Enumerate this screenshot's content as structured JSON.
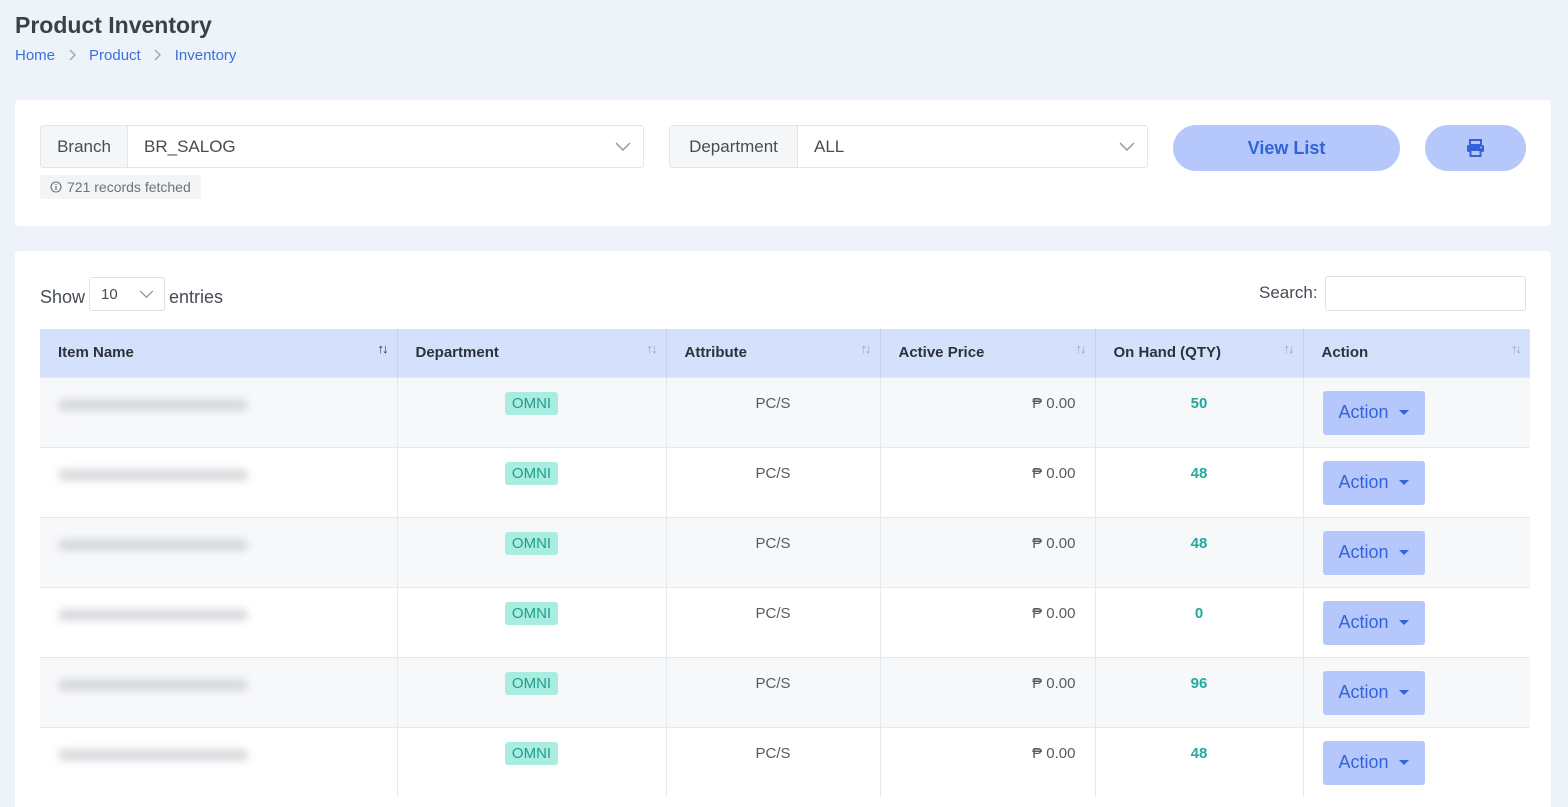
{
  "page": {
    "title": "Product Inventory",
    "breadcrumb": [
      "Home",
      "Product",
      "Inventory"
    ]
  },
  "filters": {
    "branch_label": "Branch",
    "branch_value": "BR_SALOG",
    "department_label": "Department",
    "department_value": "ALL",
    "records_fetched": "721 records fetched",
    "view_list_label": "View List",
    "print_icon": "print-icon"
  },
  "table_controls": {
    "show_label": "Show",
    "entries_value": "10",
    "entries_label": "entries",
    "search_label": "Search:",
    "search_value": ""
  },
  "columns": [
    "Item Name",
    "Department",
    "Attribute",
    "Active Price",
    "On Hand (QTY)",
    "Action"
  ],
  "rows": [
    {
      "department": "OMNI",
      "attribute": "PC/S",
      "price": "₱ 0.00",
      "qty": "50",
      "action": "Action"
    },
    {
      "department": "OMNI",
      "attribute": "PC/S",
      "price": "₱ 0.00",
      "qty": "48",
      "action": "Action"
    },
    {
      "department": "OMNI",
      "attribute": "PC/S",
      "price": "₱ 0.00",
      "qty": "48",
      "action": "Action"
    },
    {
      "department": "OMNI",
      "attribute": "PC/S",
      "price": "₱ 0.00",
      "qty": "0",
      "action": "Action"
    },
    {
      "department": "OMNI",
      "attribute": "PC/S",
      "price": "₱ 0.00",
      "qty": "96",
      "action": "Action"
    },
    {
      "department": "OMNI",
      "attribute": "PC/S",
      "price": "₱ 0.00",
      "qty": "48",
      "action": "Action"
    }
  ],
  "colors": {
    "accent": "#3264d8",
    "button_bg": "#b6c8fb",
    "header_bg": "#d5e0fd",
    "badge_bg": "#a8ede0",
    "qty_color": "#1faa9c"
  }
}
